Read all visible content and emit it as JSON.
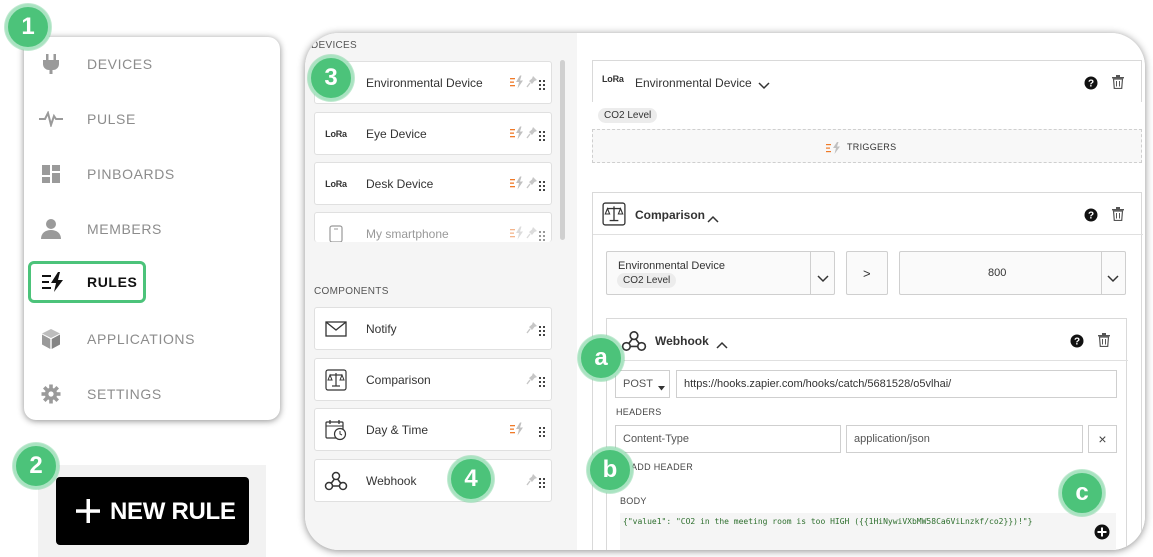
{
  "nav": {
    "items": [
      {
        "label": "DEVICES",
        "icon": "plug-icon"
      },
      {
        "label": "PULSE",
        "icon": "pulse-icon"
      },
      {
        "label": "PINBOARDS",
        "icon": "dashboard-icon"
      },
      {
        "label": "MEMBERS",
        "icon": "person-icon"
      },
      {
        "label": "RULES",
        "icon": "rules-bolt-icon"
      },
      {
        "label": "APPLICATIONS",
        "icon": "cube-icon"
      },
      {
        "label": "SETTINGS",
        "icon": "gear-icon"
      }
    ]
  },
  "new_rule": {
    "plus": "+",
    "label": "NEW RULE"
  },
  "badges": {
    "b1": "1",
    "b2": "2",
    "b3": "3",
    "b4": "4",
    "ba": "a",
    "bb": "b",
    "bc": "c"
  },
  "devices_section": {
    "title": "DEVICES",
    "items": [
      {
        "name": "Environmental Device",
        "icon": "lora-icon"
      },
      {
        "name": "Eye Device",
        "icon": "lora-icon"
      },
      {
        "name": "Desk Device",
        "icon": "lora-icon"
      },
      {
        "name": "My smartphone",
        "icon": "smartphone-icon"
      }
    ]
  },
  "lora_text": "LoRa",
  "components_section": {
    "title": "COMPONENTS",
    "items": [
      {
        "name": "Notify",
        "icon": "envelope-icon"
      },
      {
        "name": "Comparison",
        "icon": "scale-icon"
      },
      {
        "name": "Day & Time",
        "icon": "calendar-clock-icon"
      },
      {
        "name": "Webhook",
        "icon": "webhook-icon"
      }
    ]
  },
  "trigger_block": {
    "title": "Environmental Device",
    "chip": "CO2 Level",
    "triggers_label": "TRIGGERS"
  },
  "comparison_block": {
    "title": "Comparison",
    "left_device": "Environmental Device",
    "left_chip": "CO2 Level",
    "operator": ">",
    "value": "800"
  },
  "webhook_block": {
    "title": "Webhook",
    "method": "POST",
    "url": "https://hooks.zapier.com/hooks/catch/5681528/o5vlhai/",
    "headers_label": "HEADERS",
    "header_key": "Content-Type",
    "header_value": "application/json",
    "remove": "×",
    "add_header": "ADD HEADER",
    "body_label": "BODY",
    "body": "{\"value1\": \"CO2 in the meeting room is too HIGH ({{1HiNywiVXbMW58Ca6ViLnzkf/co2}})!\"}"
  },
  "colors": {
    "accent_green": "#4cc37a",
    "lightning_orange": "#f07a28"
  }
}
